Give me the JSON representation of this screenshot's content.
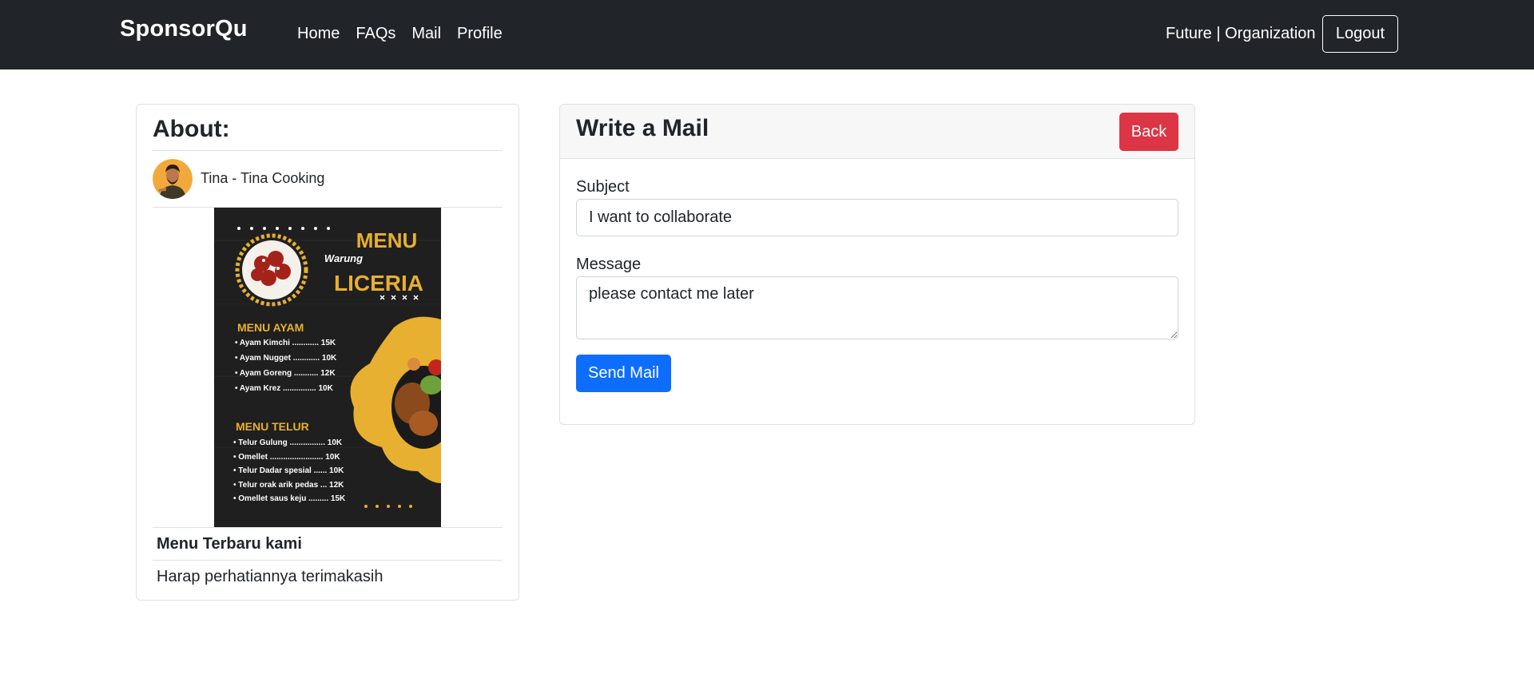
{
  "navbar": {
    "brand": "SponsorQu",
    "links": [
      {
        "label": "Home"
      },
      {
        "label": "FAQs"
      },
      {
        "label": "Mail"
      },
      {
        "label": "Profile"
      }
    ],
    "user_label": "Future | Organization",
    "logout_label": "Logout"
  },
  "about": {
    "title": "About:",
    "owner": "Tina - Tina Cooking",
    "poster": {
      "header": "MENU",
      "subtitle": "Warung",
      "name": "LICERIA",
      "sections": [
        {
          "title": "MENU AYAM",
          "items": [
            "• Ayam Kimchi ............ 15K",
            "• Ayam Nugget ............ 10K",
            "• Ayam Goreng ........... 12K",
            "• Ayam Krez ............... 10K"
          ]
        },
        {
          "title": "MENU TELUR",
          "items": [
            "• Telur Gulung ................ 10K",
            "• Omellet ........................ 10K",
            "• Telur Dadar spesial ...... 10K",
            "• Telur orak arik pedas ... 12K",
            "• Omellet saus keju ......... 15K"
          ]
        }
      ]
    },
    "post_title": "Menu Terbaru kami",
    "post_description": "Harap perhatiannya terimakasih"
  },
  "mail": {
    "title": "Write a Mail",
    "back_label": "Back",
    "subject_label": "Subject",
    "subject_value": "I want to collaborate",
    "message_label": "Message",
    "message_value": "please contact me later",
    "send_label": "Send Mail"
  },
  "colors": {
    "navbar_bg": "#212529",
    "danger": "#dc3545",
    "primary": "#0d6efd",
    "poster_accent": "#e8b030"
  }
}
